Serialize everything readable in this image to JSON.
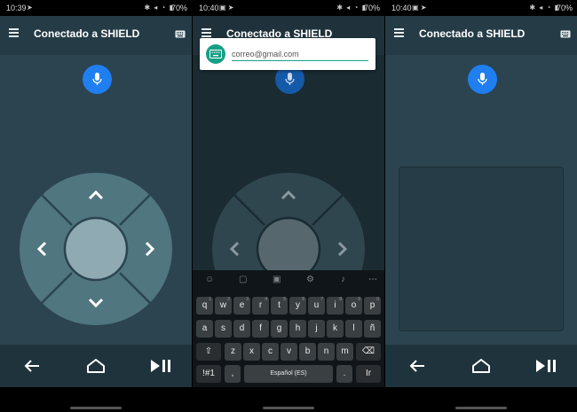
{
  "panels": [
    {
      "status": {
        "time": "10:39",
        "battery": "70%"
      },
      "appbar": {
        "title": "Conectado a SHIELD"
      }
    },
    {
      "status": {
        "time": "10:40",
        "battery": "70%"
      },
      "appbar": {
        "title": "Conectado a SHIELD"
      },
      "input": {
        "value": "correo@gmail.com"
      },
      "keyboard": {
        "row1": [
          {
            "k": "q",
            "s": "1"
          },
          {
            "k": "w",
            "s": "2"
          },
          {
            "k": "e",
            "s": "3"
          },
          {
            "k": "r",
            "s": "4"
          },
          {
            "k": "t",
            "s": "5"
          },
          {
            "k": "y",
            "s": "6"
          },
          {
            "k": "u",
            "s": "7"
          },
          {
            "k": "i",
            "s": "8"
          },
          {
            "k": "o",
            "s": "9"
          },
          {
            "k": "p",
            "s": "0"
          }
        ],
        "row2": [
          "a",
          "s",
          "d",
          "f",
          "g",
          "h",
          "j",
          "k",
          "l",
          "ñ"
        ],
        "row3": [
          "z",
          "x",
          "c",
          "v",
          "b",
          "n",
          "m"
        ],
        "row4": {
          "symbols": "!#1",
          "comma": ",",
          "space": "Español (ES)",
          "period": ".",
          "go": "Ir"
        }
      }
    },
    {
      "status": {
        "time": "10:40",
        "battery": "70%"
      },
      "appbar": {
        "title": "Conectado a SHIELD"
      }
    }
  ],
  "colors": {
    "background": "#2b4450",
    "appbar": "#253c47",
    "mic": "#1f7ff0",
    "dpad_outer": "#507680",
    "dpad_center": "#8faab2",
    "navbar": "#1f333d"
  },
  "icons": {
    "menu": "hamburger-icon",
    "keyboard": "keyboard-icon",
    "mic": "microphone-icon",
    "back": "arrow-left-icon",
    "home": "home-icon",
    "playpause": "play-pause-icon"
  }
}
